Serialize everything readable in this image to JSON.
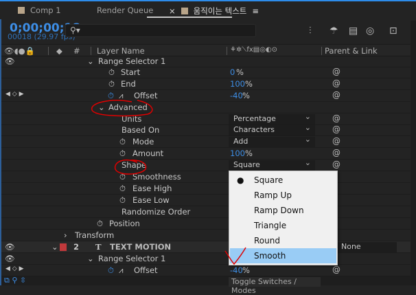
{
  "tabs": [
    {
      "label": "Comp 1"
    },
    {
      "label": "Render Queue"
    },
    {
      "label": "움직이는 텍스트",
      "active": true,
      "close": "×",
      "menu": "≡"
    }
  ],
  "timecode": "0;00;00;18",
  "frame_info": "00018 (29.97 fps)",
  "search": {
    "placeholder": "",
    "icon": "search-icon"
  },
  "header": {
    "hash": "#",
    "layer_name": "Layer Name",
    "parent": "Parent & Link",
    "switches": "⚘✲⟍fx▤◎◐⊙"
  },
  "rows": {
    "range1": "Range Selector 1",
    "start": "Start",
    "start_val": "0",
    "end": "End",
    "end_val": "100",
    "offset": "Offset",
    "offset_val": "-40",
    "advanced": "Advanced",
    "units": "Units",
    "units_val": "Percentage",
    "based_on": "Based On",
    "based_on_val": "Characters",
    "mode": "Mode",
    "mode_val": "Add",
    "amount": "Amount",
    "amount_val": "100",
    "shape": "Shape",
    "shape_val": "Square",
    "smoothness": "Smoothness",
    "ease_high": "Ease High",
    "ease_low": "Ease Low",
    "randomize": "Randomize Order",
    "position": "Position",
    "transform": "Transform",
    "layer_num": "2",
    "layer_name": "TEXT MOTION",
    "parent_val": "None",
    "range2": "Range Selector 1",
    "offset2": "Offset",
    "offset2_val": "-40",
    "pct": "%"
  },
  "menu": {
    "items": [
      "Square",
      "Ramp Up",
      "Ramp Down",
      "Triangle",
      "Round",
      "Smooth"
    ],
    "checked": "Square",
    "highlighted": "Smooth"
  },
  "bottom": {
    "toggle": "Toggle Switches / Modes"
  },
  "colors": {
    "accent": "#3d8ee6",
    "label_red": "#c0393b",
    "annotation": "#e00000"
  }
}
